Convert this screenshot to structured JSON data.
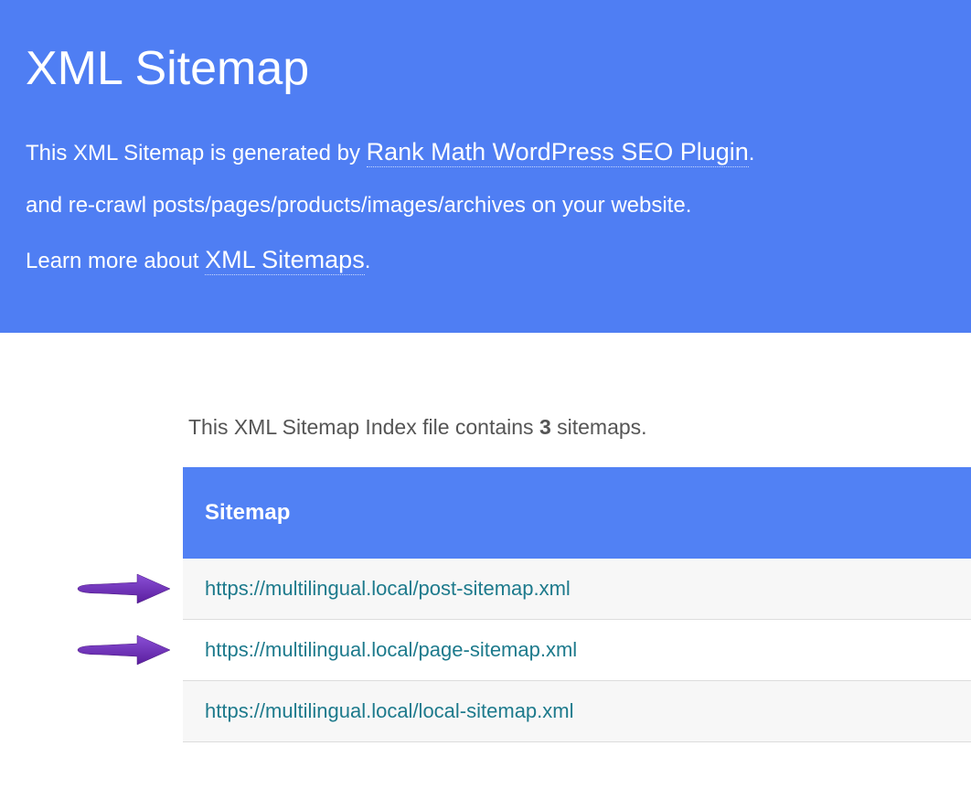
{
  "header": {
    "title": "XML Sitemap",
    "intro_prefix": "This XML Sitemap is generated by ",
    "intro_link": "Rank Math WordPress SEO Plugin",
    "intro_suffix": ".",
    "intro_line2": "and re-crawl posts/pages/products/images/archives on your website.",
    "learn_prefix": "Learn more about ",
    "learn_link": "XML Sitemaps",
    "learn_suffix": "."
  },
  "content": {
    "index_prefix": "This XML Sitemap Index file contains ",
    "index_count": "3",
    "index_suffix": " sitemaps.",
    "column_header": "Sitemap",
    "rows": [
      {
        "url": "https://multilingual.local/post-sitemap.xml",
        "has_arrow": true
      },
      {
        "url": "https://multilingual.local/page-sitemap.xml",
        "has_arrow": true
      },
      {
        "url": "https://multilingual.local/local-sitemap.xml",
        "has_arrow": false
      }
    ]
  },
  "colors": {
    "header_bg": "#4f7ef3",
    "table_header_bg": "#5181f4",
    "link_color": "#1d7a8c",
    "arrow_color": "#6b2bb3"
  }
}
